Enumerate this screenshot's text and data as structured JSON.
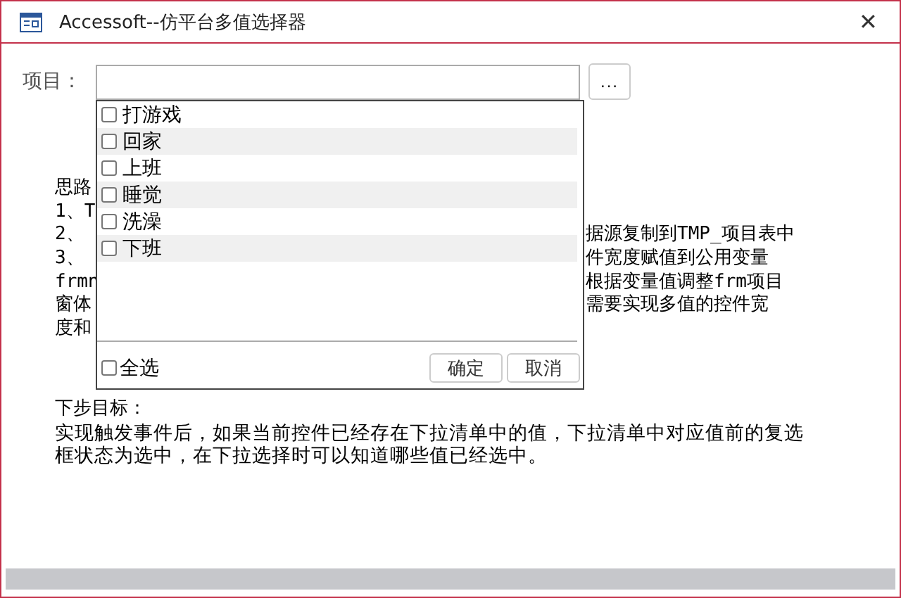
{
  "window": {
    "title": "Accessoft--仿平台多值选择器",
    "close": "✕"
  },
  "field": {
    "label": "项目：",
    "button": "..."
  },
  "dropdown": {
    "items": [
      {
        "label": "打游戏",
        "checked": false
      },
      {
        "label": "回家",
        "checked": false
      },
      {
        "label": "上班",
        "checked": false
      },
      {
        "label": "睡觉",
        "checked": false
      },
      {
        "label": "洗澡",
        "checked": false
      },
      {
        "label": "下班",
        "checked": false
      }
    ],
    "select_all": {
      "label": "全选",
      "checked": false
    },
    "buttons": [
      "确定",
      "取消"
    ]
  },
  "notes": {
    "lines": [
      {
        "left": "思路"
      },
      {
        "left": "1、T"
      },
      {
        "left": "2、",
        "right": "据源复制到TMP_项目表中"
      },
      {
        "left": "3、",
        "right": "件宽度赋值到公用变量"
      },
      {
        "left": "frmn",
        "right": "根据变量值调整frm项目"
      },
      {
        "left": "窗体",
        "right": "需要实现多值的控件宽"
      },
      {
        "left": "度和"
      }
    ]
  },
  "next_goal": {
    "heading": "下步目标：",
    "text": "实现触发事件后，如果当前控件已经存在下拉清单中的值，下拉清单中对应值前的复选框状态为选中，在下拉选择时可以知道哪些值已经选中。"
  }
}
